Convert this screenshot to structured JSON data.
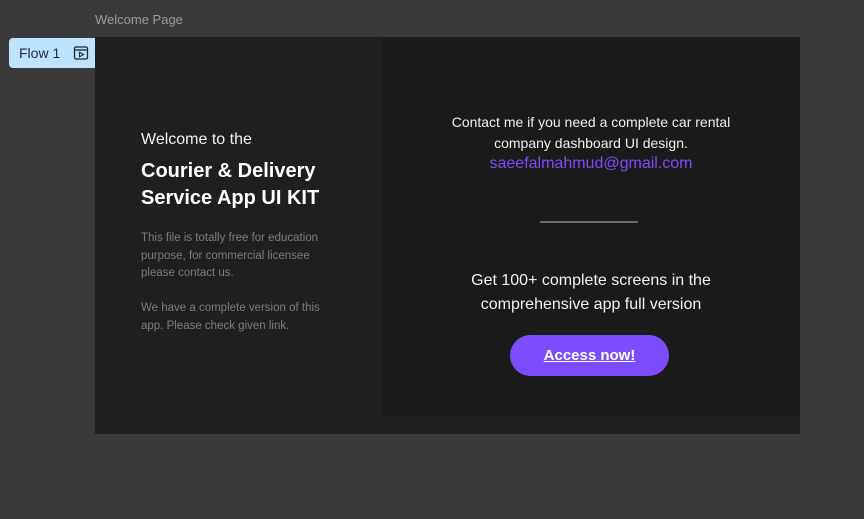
{
  "frame": {
    "title": "Welcome Page"
  },
  "flow": {
    "label": "Flow 1",
    "icon": "play-frame-icon"
  },
  "left": {
    "welcome": "Welcome to the",
    "title_line1": "Courier & Delivery",
    "title_line2": "Service App UI KIT",
    "desc1_line1": "This file is totally free for education",
    "desc1_line2": "purpose, for commercial licensee",
    "desc1_line3": "please contact us.",
    "desc2_line1": "We have a complete version of this",
    "desc2_line2": "app. Please check given link."
  },
  "right": {
    "contact_line1": "Contact me if you need a complete car rental",
    "contact_line2": "company dashboard UI design.",
    "email": "saeefalmahmud@gmail.com",
    "promo_line1": "Get 100+ complete screens in the",
    "promo_line2": "comprehensive app full version",
    "button_label": "Access now!"
  },
  "colors": {
    "accent": "#7c4dff",
    "flow_tag": "#bde3ff",
    "background": "#3a3a3a"
  }
}
